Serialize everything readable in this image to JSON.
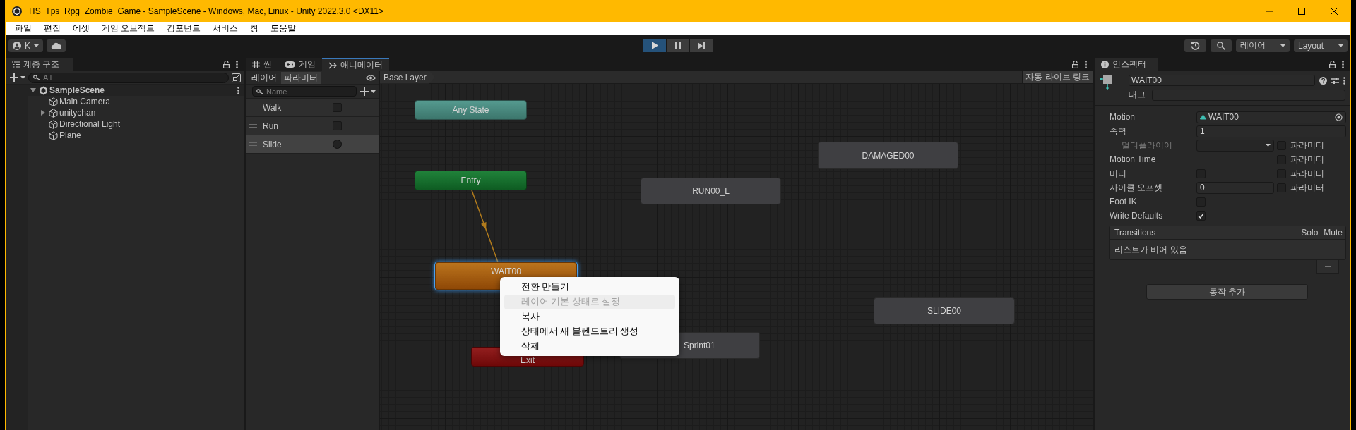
{
  "window": {
    "title": "TIS_Tps_Rpg_Zombie_Game - SampleScene - Windows, Mac, Linux - Unity 2022.3.0 <DX11>"
  },
  "menu": [
    "파일",
    "편집",
    "에셋",
    "게임 오브젝트",
    "컴포넌트",
    "서비스",
    "창",
    "도움말"
  ],
  "toolbar": {
    "account": "K",
    "playing": true,
    "layers": "레이어",
    "layout": "Layout"
  },
  "hierarchy": {
    "tab": "계층 구조",
    "search_placeholder": "All",
    "items": [
      {
        "label": "SampleScene",
        "kind": "scene",
        "expanded": true,
        "children": [
          {
            "label": "Main Camera",
            "kind": "object"
          },
          {
            "label": "unitychan",
            "kind": "object",
            "expanded": false
          },
          {
            "label": "Directional Light",
            "kind": "object"
          },
          {
            "label": "Plane",
            "kind": "object"
          }
        ]
      }
    ]
  },
  "animator": {
    "tabs": [
      {
        "label": "씬",
        "kind": "scene",
        "selected": false
      },
      {
        "label": "게임",
        "kind": "game",
        "selected": false
      },
      {
        "label": "애니메이터",
        "kind": "animator",
        "selected": true
      }
    ],
    "sub_tabs": [
      {
        "label": "레이어",
        "selected": false
      },
      {
        "label": "파라미터",
        "selected": true
      }
    ],
    "param_search_placeholder": "Name",
    "parameters": [
      {
        "name": "Walk",
        "kind": "bool",
        "value": false,
        "selected": false
      },
      {
        "name": "Run",
        "kind": "bool",
        "value": false,
        "selected": false
      },
      {
        "name": "Slide",
        "kind": "trigger",
        "value": false,
        "selected": true
      }
    ],
    "graph": {
      "breadcrumb": "Base Layer",
      "live_link": "자동 라이브 링크",
      "nodes": [
        {
          "label": "Any State",
          "kind": "any",
          "selected": false
        },
        {
          "label": "Entry",
          "kind": "entry",
          "selected": false
        },
        {
          "label": "DAMAGED00",
          "kind": "state",
          "selected": false
        },
        {
          "label": "RUN00_L",
          "kind": "state",
          "selected": false
        },
        {
          "label": "WAIT00",
          "kind": "default",
          "selected": true
        },
        {
          "label": "SLIDE00",
          "kind": "state",
          "selected": false
        },
        {
          "label": "Sprint01",
          "kind": "state",
          "selected": false
        },
        {
          "label": "Exit",
          "kind": "exit",
          "selected": false
        }
      ],
      "context_menu": [
        {
          "label": "전환 만들기",
          "disabled": false,
          "highlighted": false
        },
        {
          "label": "레이어 기본 상태로 설정",
          "disabled": true,
          "highlighted": true
        },
        {
          "label": "복사",
          "disabled": false,
          "highlighted": false
        },
        {
          "label": "상태에서 새 블렌드트리 생성",
          "disabled": false,
          "highlighted": false
        },
        {
          "label": "삭제",
          "disabled": false,
          "highlighted": false
        }
      ]
    }
  },
  "inspector": {
    "tab": "인스펙터",
    "name": "WAIT00",
    "tag_label": "태그",
    "fields": [
      {
        "kind": "object",
        "label": "Motion",
        "value": "WAIT00"
      },
      {
        "kind": "text",
        "label": "속력",
        "value": "1"
      },
      {
        "kind": "dropdown",
        "label": "멀티플라이어",
        "disabled": true,
        "param": {
          "label": "파라미터",
          "checked": false
        }
      },
      {
        "kind": "none",
        "label": "Motion Time",
        "param": {
          "label": "파라미터",
          "checked": false
        }
      },
      {
        "kind": "check",
        "label": "미러",
        "checked": false,
        "param": {
          "label": "파라미터",
          "checked": false
        }
      },
      {
        "kind": "text",
        "label": "사이클 오프셋",
        "value": "0",
        "param": {
          "label": "파라미터",
          "checked": false
        }
      },
      {
        "kind": "check",
        "label": "Foot IK",
        "checked": false
      },
      {
        "kind": "check",
        "label": "Write Defaults",
        "checked": true
      }
    ],
    "transitions": {
      "title": "Transitions",
      "solo": "Solo",
      "mute": "Mute",
      "empty": "리스트가 비어 있음"
    },
    "add_button": "동작 추가"
  }
}
